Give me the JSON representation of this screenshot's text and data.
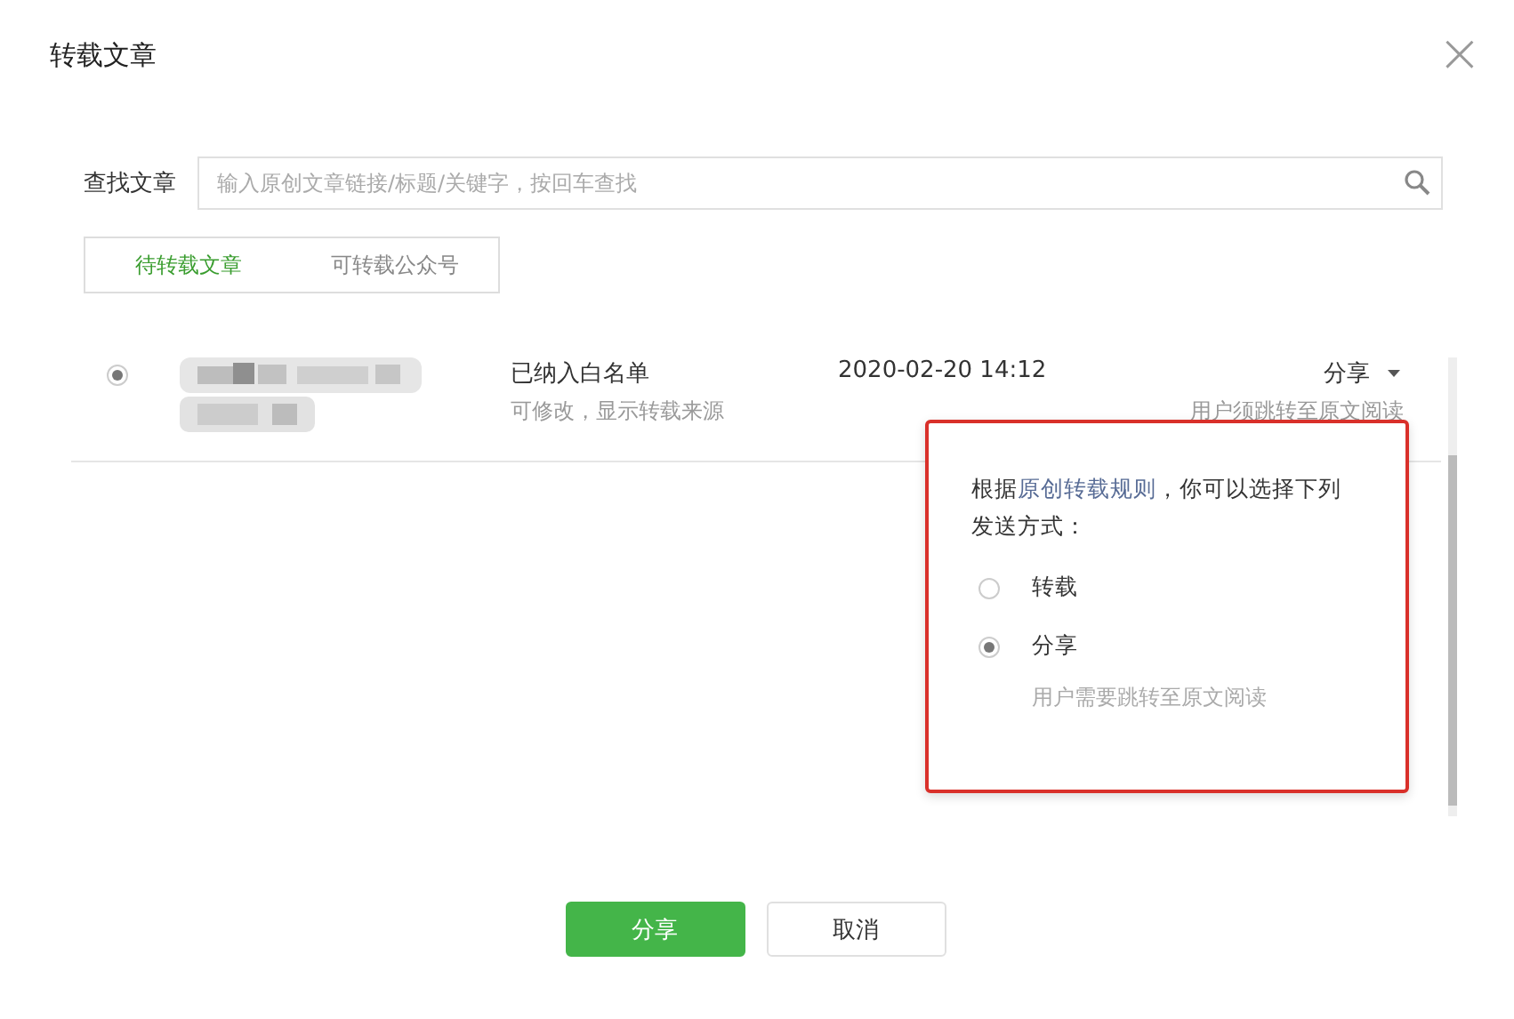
{
  "dialog": {
    "title": "转载文章",
    "close": "×"
  },
  "search": {
    "label": "查找文章",
    "placeholder": "输入原创文章链接/标题/关键字，按回车查找"
  },
  "tabs": [
    {
      "label": "待转载文章",
      "selected": true
    },
    {
      "label": "可转载公众号",
      "selected": false
    }
  ],
  "rows": [
    {
      "selected": true,
      "status": "已纳入白名单",
      "status_note": "可修改，显示转载来源",
      "date": "2020-02-20 14:12",
      "mode": "分享",
      "mode_note": "用户须跳转至原文阅读"
    }
  ],
  "popover": {
    "intro_before": "根据",
    "intro_link": "原创转载规则",
    "intro_after": "，你可以选择下列发送方式：",
    "options": [
      {
        "label": "转载",
        "selected": false
      },
      {
        "label": "分享",
        "selected": true,
        "note": "用户需要跳转至原文阅读"
      }
    ]
  },
  "buttons": [
    {
      "label": "分享",
      "kind": "primary"
    },
    {
      "label": "取消",
      "kind": "secondary"
    }
  ]
}
